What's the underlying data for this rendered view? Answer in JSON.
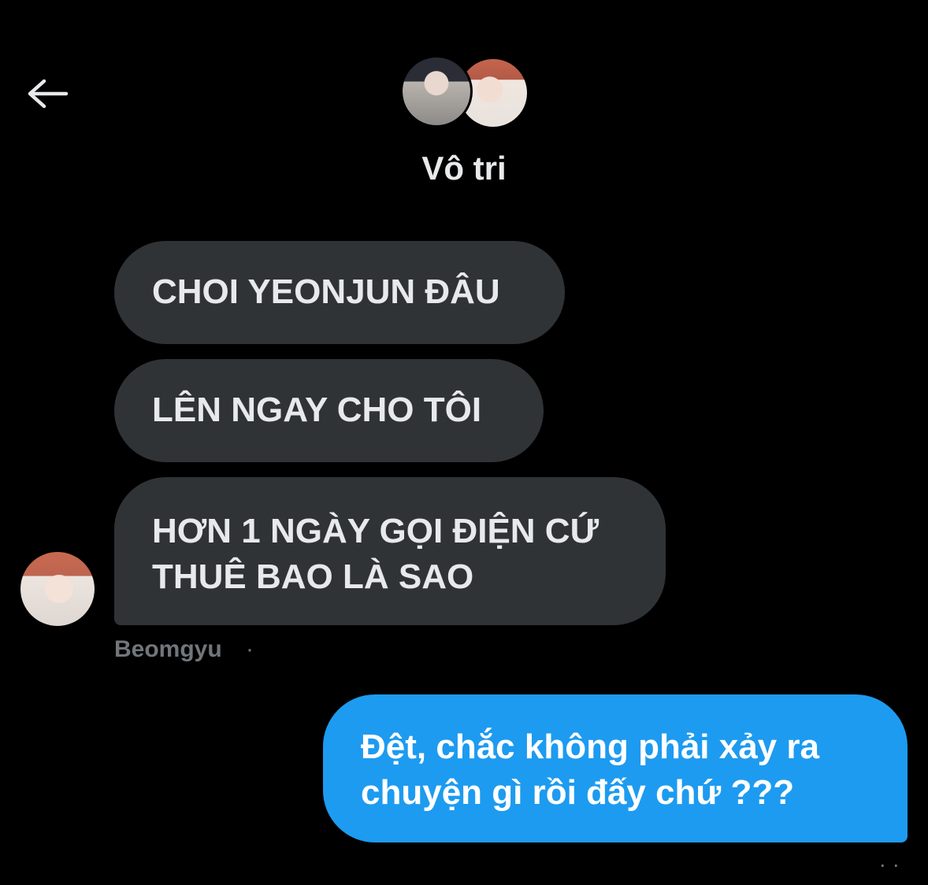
{
  "header": {
    "back_icon": "arrow-left-icon",
    "title": "Vô tri"
  },
  "messages": [
    {
      "direction": "incoming",
      "text": "CHOI YEONJUN ĐÂU"
    },
    {
      "direction": "incoming",
      "text": "LÊN NGAY CHO TÔI"
    },
    {
      "direction": "incoming",
      "text": "HƠN 1 NGÀY GỌI ĐIỆN CỨ THUÊ BAO LÀ SAO"
    },
    {
      "direction": "outgoing",
      "text": "Đệt, chắc không phải xảy ra chuyện gì rồi đấy chứ ???"
    }
  ],
  "sender": {
    "name": "Beomgyu",
    "separator": "·"
  },
  "outgoing_meta": {
    "time": "· ·"
  },
  "colors": {
    "background": "#000000",
    "incoming_bubble": "#2f3336",
    "outgoing_bubble": "#1d9bf0",
    "muted_text": "#71767b"
  }
}
